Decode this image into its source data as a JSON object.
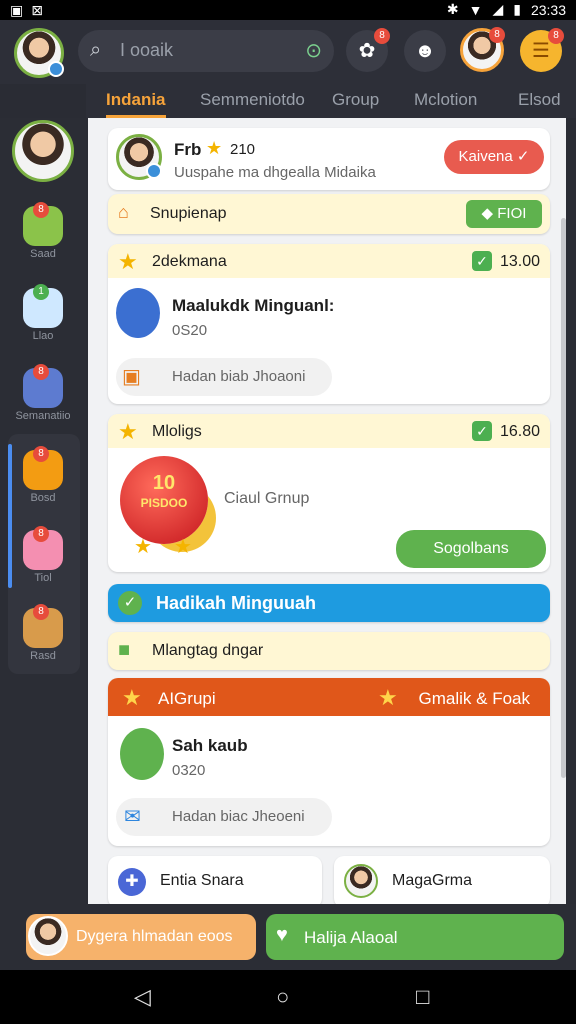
{
  "status": {
    "time": "23:33"
  },
  "search": {
    "placeholder": "I ooaik"
  },
  "tabs": [
    "Indania",
    "Semmeniotdo",
    "Group",
    "Mclotion",
    "Elsod"
  ],
  "sidebar": {
    "items": [
      {
        "label": "Saad",
        "icon": "puzzle-icon",
        "color": "#8bc34a"
      },
      {
        "label": "Llao",
        "icon": "cloud-pet-icon",
        "color": "#cfe8ff"
      },
      {
        "label": "Semanatiio",
        "icon": "monster-icon",
        "color": "#5d7bd0"
      },
      {
        "label": "Bosd",
        "icon": "cat-icon",
        "color": "#f39c12"
      },
      {
        "label": "Tiol",
        "icon": "pig-icon",
        "color": "#f48fb1"
      },
      {
        "label": "Rasd",
        "icon": "lion-icon",
        "color": "#d89b4b"
      }
    ]
  },
  "profile_card": {
    "name": "Frb",
    "points": "210",
    "subtitle": "Uuspahe ma dhgealla Midaika",
    "button": "Kaivena"
  },
  "sugest_bar": {
    "label": "Snupienap",
    "button": "FIOI"
  },
  "task1": {
    "header": "2dekmana",
    "value": "13.00",
    "title": "Maalukdk Minguanl:",
    "sub": "0S20",
    "gift_label": "Hadan biab Jhoaoni"
  },
  "task2": {
    "header": "Mloligs",
    "value": "16.80",
    "badge_num": "10",
    "badge_txt": "PISDOO",
    "side_text": "Ciaul Grnup",
    "button": "Sogolbans"
  },
  "banner": {
    "label": "Hadikah Minguuah"
  },
  "notice": {
    "label": "Mlangtag dngar"
  },
  "group_head": {
    "left": "AIGrupi",
    "right": "Gmalik & Foak"
  },
  "task3": {
    "title": "Sah kaub",
    "sub": "0320",
    "gift_label": "Hadan biac Jheoeni"
  },
  "mini_cards": [
    {
      "label": "Entia Snara"
    },
    {
      "label": "MagaGrma"
    }
  ],
  "bottom": {
    "left_label": "Dygera hlmadan eoos",
    "right_label": "Halija Alaoal"
  },
  "colors": {
    "accent": "#f6a33a",
    "green": "#5fb24e",
    "blue_banner": "#1e9be0",
    "orange_head": "#e0571a"
  }
}
